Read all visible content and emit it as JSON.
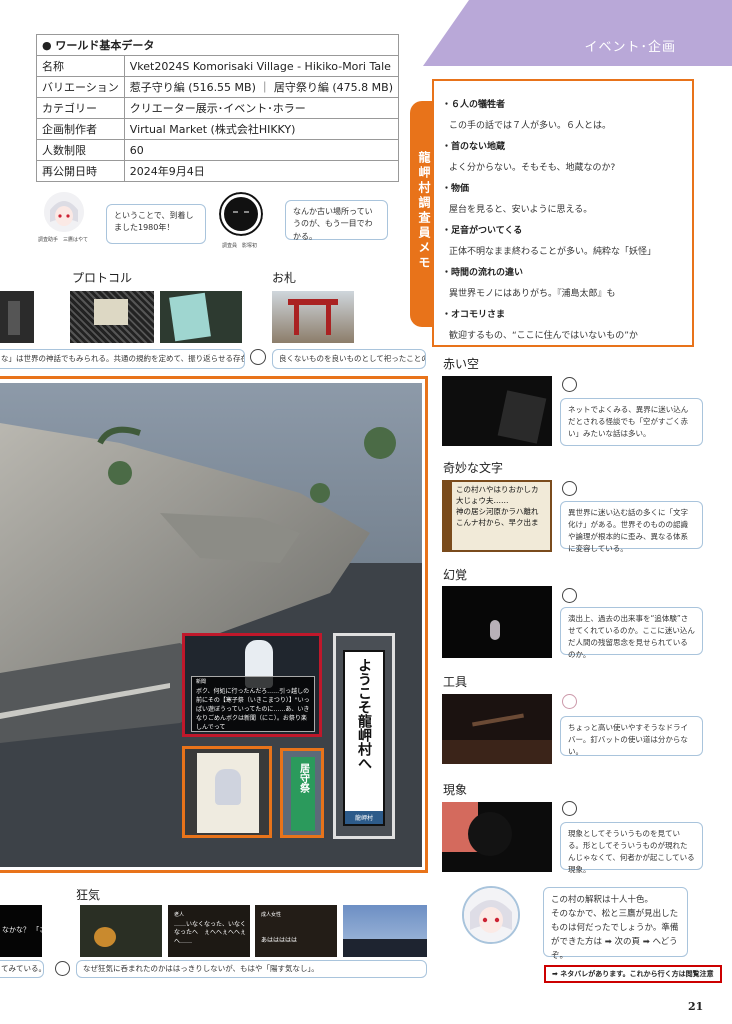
{
  "header": {
    "section_title": "イベント･企画"
  },
  "world_data": {
    "heading": "● ワールド基本データ",
    "rows": [
      {
        "key": "名称",
        "value": "Vket2024S Komorisaki Village - Hikiko-Mori Tale"
      },
      {
        "key": "バリエーション",
        "value": "惹子守り編 (516.55 MB) ｜ 居守祭り編 (475.8 MB)"
      },
      {
        "key": "カテゴリー",
        "value": "クリエーター展示･イベント･ホラー"
      },
      {
        "key": "企画制作者",
        "value": "Virtual Market (株式会社HIKKY)"
      },
      {
        "key": "人数制限",
        "value": "60"
      },
      {
        "key": "再公開日時",
        "value": "2024年9月4日"
      }
    ]
  },
  "comments_top": [
    {
      "caption": "調査助手　三鷹はやて",
      "text": "ということで、到着しました1980年！"
    },
    {
      "caption": "調査員　影塚初",
      "text": "なんか古い場所っていうのが、もう一目でわかる。"
    }
  ],
  "protocol": {
    "title": "プロトコル",
    "note": "な」は世界の神話でもみられる。共通の規約を定めて、振り返らせる存在を分別する"
  },
  "ofuda": {
    "title": "お札",
    "note": "良くないものを良いものとして祀ったことの名残か"
  },
  "memo": {
    "tab_label": "龍岬村調査員メモ",
    "items": [
      {
        "title": "・６人の犠牲者",
        "desc": "この手の話では７人が多い。６人とは。"
      },
      {
        "title": "・首のない地蔵",
        "desc": "よく分からない。そもそも、地蔵なのか?"
      },
      {
        "title": "・物価",
        "desc": "屋台を見ると、安いように思える。"
      },
      {
        "title": "・足音がついてくる",
        "desc": "正体不明なまま終わることが多い。純粋な「妖怪」"
      },
      {
        "title": "・時間の流れの違い",
        "desc": "異世界モノにはありがち。『浦島太郎』も"
      },
      {
        "title": "・オコモリさま",
        "desc": "歓迎するもの、“ここに住んではいないもの”か"
      }
    ]
  },
  "side_items": [
    {
      "title": "赤い空",
      "note": "ネットでよくみる、異界に迷い込んだとされる怪談でも「空がすごく赤い」みたいな話は多い。"
    },
    {
      "title": "奇妙な文字",
      "note": "異世界に迷い込む話の多くに「文字化け」がある。世界そのものの認識や論理が根本的に歪み、異なる体系に変容している。",
      "sign_lines": [
        "この村ハやはりおかしカ",
        "大じょウ夫……",
        "神の居シ河原かラハ離れ",
        "こんナ村から、早ク出ま"
      ]
    },
    {
      "title": "幻覚",
      "note": "演出上、過去の出来事を“追体験”させてくれているのか。ここに迷い込んだ人間の残留思念を見せられているのか。"
    },
    {
      "title": "工具",
      "note": "ちょっと高い使いやすそうなドライバー。釘バットの使い道は分からない。"
    },
    {
      "title": "現象",
      "note": "現象としてそういうものを見ている。形としてそういうものが現れたんじゃなくて、何者かが起こしている現象。"
    }
  ],
  "closing_comment": {
    "lines": [
      "この村の解釈は十人十色。",
      "そのなかで、松と三鷹が見出したものは何だったでしょうか。準備ができた方は ➡ 次の頁 ➡ へどうぞ。"
    ],
    "next_label": "次の頁",
    "warning": "➡ ネタバレがあります。これから行く方は閲覧注意"
  },
  "main_image": {
    "dialog_label": "新聞",
    "dialog_text": "ボク、何処に行ったんだろ……引っ越しの前にその【寒子祭（いきこまつり）】\"いっぱい遊ぼうっていってたのに……あ、いきなりごめんボクは新聞（にこ）。お祭り楽しんでって",
    "sign_text": "ようこそ龍岬村へ",
    "sign_foot": "龍岬村",
    "banner_text": "居守祭"
  },
  "madness": {
    "title": "狂気",
    "note": "なぜ狂気に呑まれたのかははっきりしないが、もはや「陽す気なし」。",
    "left_note": "てみている。",
    "left_text": "なかな？ 「さ",
    "thumb_labels": [
      "老人",
      "成人女性"
    ],
    "thumb_texts": [
      "……いなくなった、いなくなったへ　ぇへへぇへへぇへ……",
      "あははははは"
    ]
  },
  "page_number": "21",
  "colors": {
    "accent": "#e8731a",
    "banner": "#b9a8d8",
    "bubble_border": "#a9c4dc",
    "warning": "#cc0000"
  }
}
